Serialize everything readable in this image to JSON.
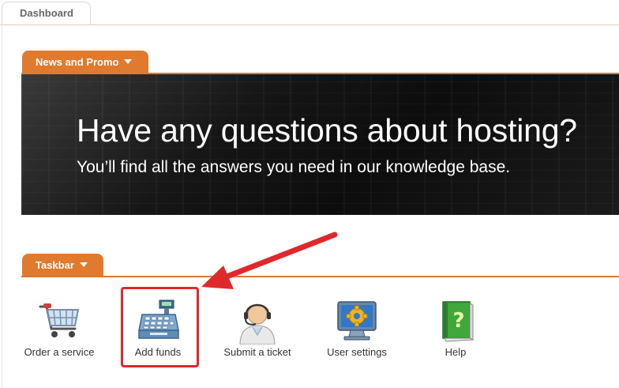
{
  "tabs": {
    "dashboard": "Dashboard"
  },
  "news": {
    "tab_label": "News and Promo",
    "banner_title": "Have any questions about hosting?",
    "banner_subtitle": "You’ll find all the answers you need in our knowledge base."
  },
  "taskbar": {
    "tab_label": "Taskbar",
    "items": [
      {
        "label": "Order a service",
        "icon": "shopping-cart-icon"
      },
      {
        "label": "Add funds",
        "icon": "cash-register-icon"
      },
      {
        "label": "Submit a ticket",
        "icon": "support-agent-icon"
      },
      {
        "label": "User settings",
        "icon": "monitor-gear-icon"
      },
      {
        "label": "Help",
        "icon": "help-book-icon"
      }
    ]
  },
  "colors": {
    "accent": "#e07a2e",
    "highlight": "#e0282c"
  }
}
